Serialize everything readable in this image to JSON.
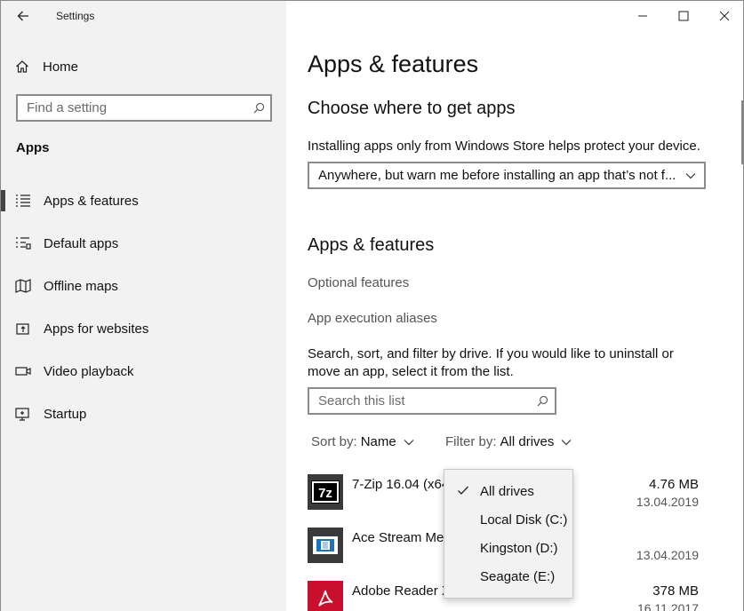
{
  "window": {
    "title": "Settings"
  },
  "sidebar": {
    "home_label": "Home",
    "search_placeholder": "Find a setting",
    "section_label": "Apps",
    "items": [
      {
        "label": "Apps & features",
        "icon": "apps-features-icon",
        "active": true
      },
      {
        "label": "Default apps",
        "icon": "default-apps-icon",
        "active": false
      },
      {
        "label": "Offline maps",
        "icon": "offline-maps-icon",
        "active": false
      },
      {
        "label": "Apps for websites",
        "icon": "apps-for-websites-icon",
        "active": false
      },
      {
        "label": "Video playback",
        "icon": "video-playback-icon",
        "active": false
      },
      {
        "label": "Startup",
        "icon": "startup-icon",
        "active": false
      }
    ]
  },
  "main": {
    "page_title": "Apps & features",
    "choose_heading": "Choose where to get apps",
    "choose_desc": "Installing apps only from Windows Store helps protect your device.",
    "source_dropdown_value": "Anywhere, but warn me before installing an app that’s not f...",
    "apps_heading": "Apps & features",
    "optional_features_link": "Optional features",
    "app_execution_aliases_link": "App execution aliases",
    "search_desc_line1": "Search, sort, and filter by drive. If you would like to uninstall or",
    "search_desc_line2": "move an app, select it from the list.",
    "list_search_placeholder": "Search this list",
    "sort_label": "Sort by:",
    "sort_value": "Name",
    "filter_label": "Filter by:",
    "filter_value": "All drives",
    "apps": [
      {
        "name": "7-Zip 16.04 (x64",
        "size": "4.76 MB",
        "date": "13.04.2019"
      },
      {
        "name": "Ace Stream Med",
        "size": "",
        "date": "13.04.2019"
      },
      {
        "name": "Adobe Reader X",
        "size": "378 MB",
        "date": "16.11.2017"
      }
    ]
  },
  "drive_filter_popup": {
    "options": [
      {
        "label": "All drives",
        "checked": true
      },
      {
        "label": "Local Disk (C:)",
        "checked": false
      },
      {
        "label": "Kingston (D:)",
        "checked": false
      },
      {
        "label": "Seagate (E:)",
        "checked": false
      }
    ]
  },
  "colors": {
    "sidebar_bg": "#f2f2f2",
    "border": "#8c8c8c",
    "adobe_red": "#c8102e",
    "ace_blue": "#1e73be"
  }
}
